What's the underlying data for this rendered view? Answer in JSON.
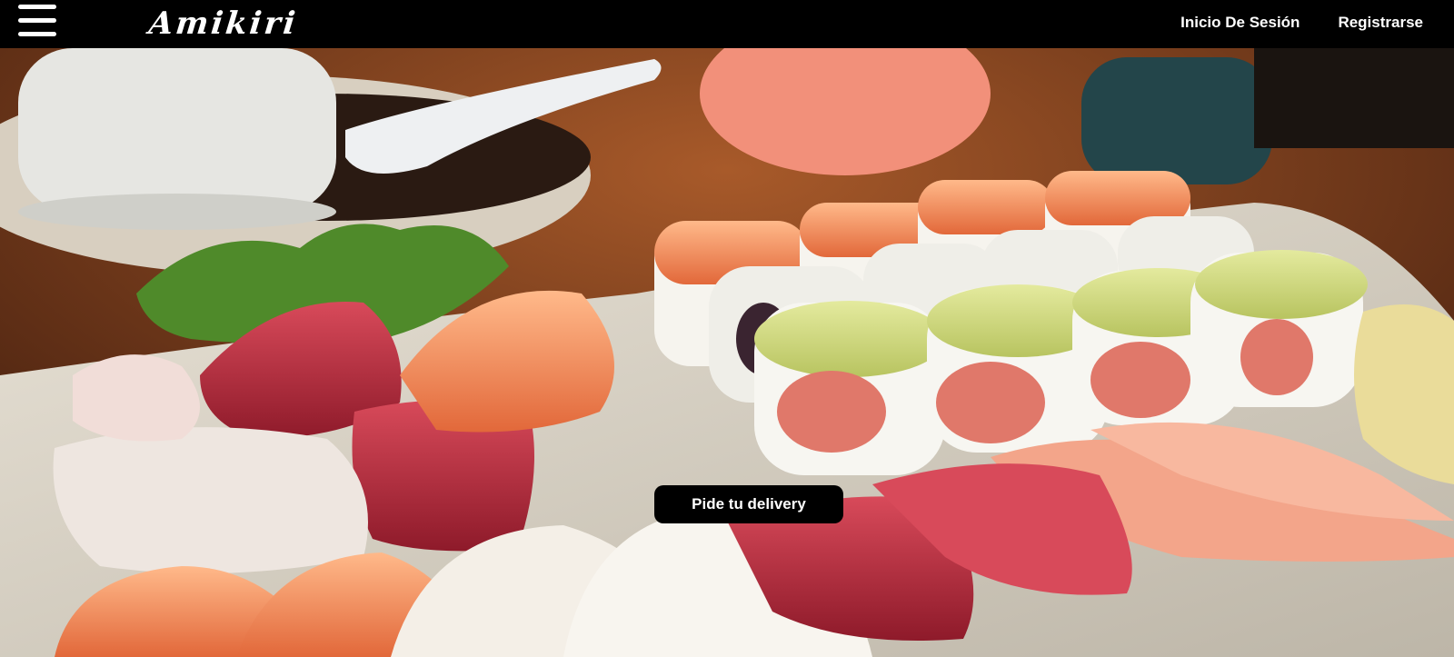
{
  "header": {
    "brand": "Amikiri",
    "nav": {
      "login": "Inicio De Sesión",
      "register": "Registrarse"
    }
  },
  "hero": {
    "cta_label": "Pide tu delivery",
    "image": "sushi-platter-photo"
  },
  "colors": {
    "header_bg": "#000000",
    "cta_bg": "#000000",
    "text": "#ffffff"
  }
}
